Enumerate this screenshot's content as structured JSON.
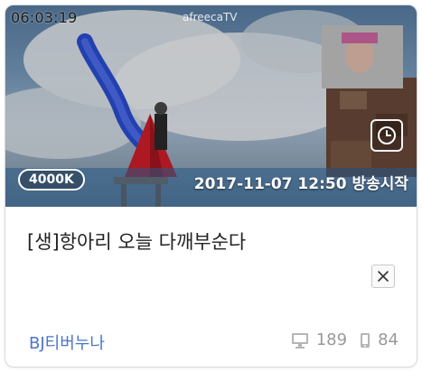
{
  "broadcast": {
    "duration": "06:03:19",
    "watermark": "afreecaTV",
    "viewer_badge": "4000K",
    "start_time": "2017-11-07 12:50 방송시작",
    "title": "[생]항아리 오늘 다깨부순다",
    "bj_name": "BJ티버누나",
    "pc_viewers": "189",
    "mobile_viewers": "84"
  },
  "icons": {
    "watch_later": "clock-icon",
    "close": "close-icon",
    "pc": "monitor-icon",
    "mobile": "phone-icon"
  },
  "colors": {
    "bj_link": "#4a74c9",
    "stats_text": "#999999",
    "title_text": "#222222"
  }
}
